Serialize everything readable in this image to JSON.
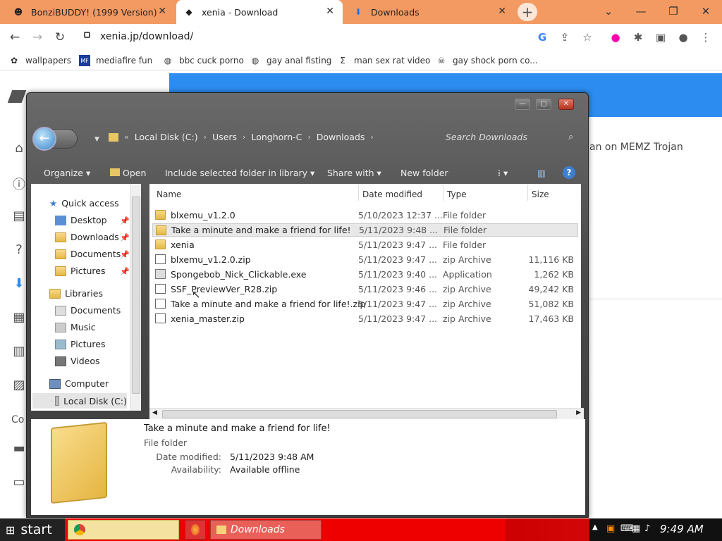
{
  "browser": {
    "tabs": [
      {
        "title": "BonziBUDDY! (1999 Version)",
        "icon": "purple-face-icon"
      },
      {
        "title": "xenia - Download",
        "icon": "xenia-icon"
      },
      {
        "title": "Downloads",
        "icon": "download-icon"
      }
    ],
    "url": "xenia.jp/download/",
    "bookmarks": [
      "wallpapers",
      "mediafire fun",
      "bbc cuck porno",
      "gay anal fisting",
      "man sex rat video",
      "gay shock porn co..."
    ]
  },
  "page": {
    "bg_text": "an on MEMZ Trojan",
    "bg_co": "Co"
  },
  "explorer": {
    "breadcrumb": [
      "Local Disk (C:)",
      "Users",
      "Longhorn-C",
      "Downloads"
    ],
    "search_placeholder": "Search Downloads",
    "toolbar": {
      "organize": "Organize ▾",
      "open": "Open",
      "include": "Include selected folder in library ▾",
      "share": "Share with ▾",
      "new_folder": "New folder",
      "help": "?"
    },
    "nav": {
      "quick_access": "Quick access",
      "desktop": "Desktop",
      "downloads": "Downloads",
      "documents": "Documents",
      "pictures": "Pictures",
      "libraries": "Libraries",
      "lib_documents": "Documents",
      "music": "Music",
      "lib_pictures": "Pictures",
      "videos": "Videos",
      "computer": "Computer",
      "local_disk": "Local Disk (C:)"
    },
    "columns": {
      "name": "Name",
      "date": "Date modified",
      "type": "Type",
      "size": "Size"
    },
    "files": [
      {
        "name": "blxemu_v1.2.0",
        "date": "5/10/2023 12:37 ...",
        "type": "File folder",
        "size": ""
      },
      {
        "name": "Take a minute and make a friend for life!",
        "date": "5/11/2023 9:48 ...",
        "type": "File folder",
        "size": ""
      },
      {
        "name": "xenia",
        "date": "5/11/2023 9:47 ...",
        "type": "File folder",
        "size": ""
      },
      {
        "name": "blxemu_v1.2.0.zip",
        "date": "5/11/2023 9:47 ...",
        "type": "zip Archive",
        "size": "11,116 KB"
      },
      {
        "name": "Spongebob_Nick_Clickable.exe",
        "date": "5/11/2023 9:40 ...",
        "type": "Application",
        "size": "1,262 KB"
      },
      {
        "name": "SSF_PreviewVer_R28.zip",
        "date": "5/11/2023 9:46 ...",
        "type": "zip Archive",
        "size": "49,242 KB"
      },
      {
        "name": "Take a minute and make a friend for life!.zip",
        "date": "5/11/2023 9:47 ...",
        "type": "zip Archive",
        "size": "51,082 KB"
      },
      {
        "name": "xenia_master.zip",
        "date": "5/11/2023 9:47 ...",
        "type": "zip Archive",
        "size": "17,463 KB"
      }
    ],
    "details": {
      "name": "Take a minute and make a friend for life!",
      "type": "File folder",
      "date_label": "Date modified:",
      "date_value": "5/11/2023 9:48 AM",
      "avail_label": "Availability:",
      "avail_value": "Available offline"
    }
  },
  "taskbar": {
    "start": "start",
    "active_task": "Downloads",
    "clock": "9:49 AM"
  }
}
